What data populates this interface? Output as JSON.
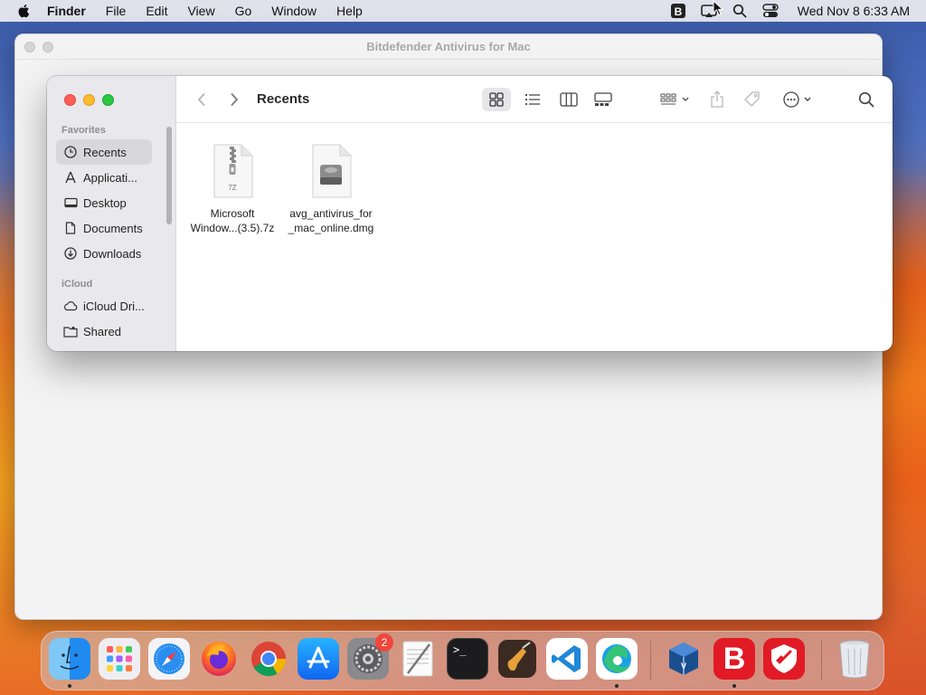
{
  "menubar": {
    "app_name": "Finder",
    "items": [
      "File",
      "Edit",
      "View",
      "Go",
      "Window",
      "Help"
    ],
    "clock": "Wed Nov 8  6:33 AM"
  },
  "background_window": {
    "title": "Bitdefender Antivirus for Mac"
  },
  "finder": {
    "title": "Recents",
    "sidebar": {
      "favorites_header": "Favorites",
      "favorites": [
        {
          "label": "Recents",
          "icon": "clock-icon",
          "active": true
        },
        {
          "label": "Applicati...",
          "icon": "applications-icon",
          "active": false
        },
        {
          "label": "Desktop",
          "icon": "desktop-icon",
          "active": false
        },
        {
          "label": "Documents",
          "icon": "document-icon",
          "active": false
        },
        {
          "label": "Downloads",
          "icon": "download-icon",
          "active": false
        }
      ],
      "icloud_header": "iCloud",
      "icloud": [
        {
          "label": "iCloud Dri...",
          "icon": "cloud-icon"
        },
        {
          "label": "Shared",
          "icon": "shared-folder-icon"
        }
      ]
    },
    "files": [
      {
        "line1": "Microsoft",
        "line2": "Window...(3.5).7z",
        "type_label": "7Z",
        "kind": "archive"
      },
      {
        "line1": "avg_antivirus_for",
        "line2": "_mac_online.dmg",
        "type_label": "",
        "kind": "disk-image"
      }
    ]
  },
  "dock": {
    "apps": [
      {
        "name": "Finder",
        "icon": "finder-icon",
        "running": true
      },
      {
        "name": "Launchpad",
        "icon": "launchpad-icon",
        "running": false
      },
      {
        "name": "Safari",
        "icon": "safari-icon",
        "running": false
      },
      {
        "name": "Firefox",
        "icon": "firefox-icon",
        "running": false
      },
      {
        "name": "Chrome",
        "icon": "chrome-icon",
        "running": false
      },
      {
        "name": "App Store",
        "icon": "app-store-icon",
        "running": false
      },
      {
        "name": "System Settings",
        "icon": "system-settings-icon",
        "running": false,
        "badge": "2"
      },
      {
        "name": "TextEdit",
        "icon": "textedit-icon",
        "running": false
      },
      {
        "name": "Terminal",
        "icon": "terminal-icon",
        "running": false
      },
      {
        "name": "GarageBand",
        "icon": "garageband-icon",
        "running": false
      },
      {
        "name": "VS Code",
        "icon": "vscode-icon",
        "running": false
      },
      {
        "name": "Edge",
        "icon": "edge-icon",
        "running": true
      },
      {
        "name": "VirtualBox",
        "icon": "virtualbox-icon",
        "running": false
      },
      {
        "name": "Bitdefender",
        "icon": "bitdefender-icon",
        "running": true
      },
      {
        "name": "Bitdefender VPN",
        "icon": "bitdefender-vpn-icon",
        "running": false
      },
      {
        "name": "Trash",
        "icon": "trash-icon",
        "running": false
      }
    ],
    "terminal_prompt": ">_",
    "bitdefender_letter": "B"
  }
}
